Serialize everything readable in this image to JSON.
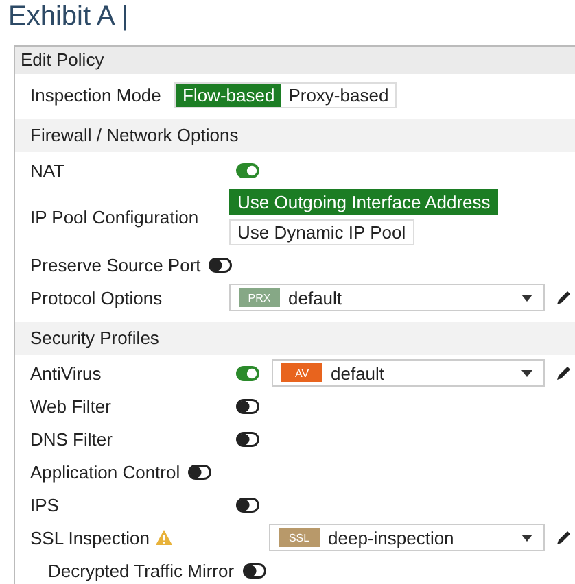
{
  "heading": "Exhibit A |",
  "panel": {
    "title": "Edit Policy",
    "inspection_mode": {
      "label": "Inspection Mode",
      "options": [
        {
          "label": "Flow-based",
          "selected": true
        },
        {
          "label": "Proxy-based",
          "selected": false
        }
      ]
    },
    "sections": [
      {
        "title": "Firewall / Network Options",
        "rows": [
          {
            "kind": "toggle",
            "label": "NAT",
            "on": true
          },
          {
            "kind": "choice",
            "label": "IP Pool Configuration",
            "options": [
              {
                "label": "Use Outgoing Interface Address",
                "selected": true
              },
              {
                "label": "Use Dynamic IP Pool",
                "selected": false
              }
            ]
          },
          {
            "kind": "toggle",
            "label": "Preserve Source Port",
            "on": false
          },
          {
            "kind": "select",
            "label": "Protocol Options",
            "tag": "PRX",
            "color": "#86a886",
            "value": "default"
          }
        ]
      },
      {
        "title": "Security Profiles",
        "rows": [
          {
            "kind": "toggle-select",
            "label": "AntiVirus",
            "on": true,
            "tag": "AV",
            "color": "#e8641e",
            "value": "default"
          },
          {
            "kind": "toggle",
            "label": "Web Filter",
            "on": false
          },
          {
            "kind": "toggle",
            "label": "DNS Filter",
            "on": false
          },
          {
            "kind": "toggle",
            "label": "Application Control",
            "on": false
          },
          {
            "kind": "toggle",
            "label": "IPS",
            "on": false
          },
          {
            "kind": "select",
            "label": "SSL Inspection",
            "warning": true,
            "tag": "SSL",
            "color": "#b8996a",
            "value": "deep-inspection",
            "children": [
              {
                "kind": "toggle",
                "label": "Decrypted Traffic Mirror",
                "on": false
              }
            ]
          }
        ]
      }
    ]
  }
}
